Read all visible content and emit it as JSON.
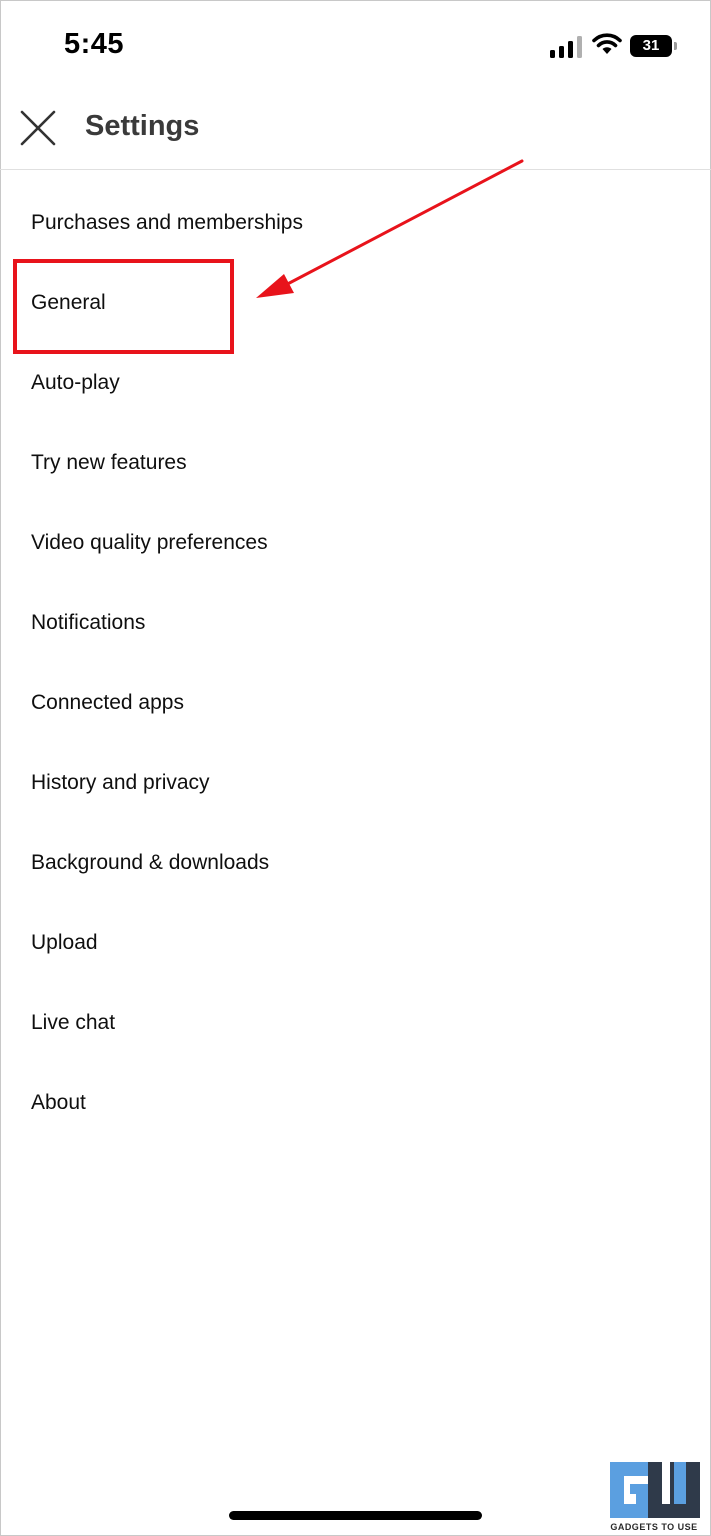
{
  "status_bar": {
    "time": "5:45",
    "battery_level": "31",
    "icons": [
      "signal-bars-icon",
      "wifi-icon",
      "battery-icon"
    ]
  },
  "header": {
    "title": "Settings",
    "close_icon": "close-x-icon"
  },
  "settings": {
    "items": [
      {
        "label": "Purchases and memberships"
      },
      {
        "label": "General"
      },
      {
        "label": "Auto-play"
      },
      {
        "label": "Try new features"
      },
      {
        "label": "Video quality preferences"
      },
      {
        "label": "Notifications"
      },
      {
        "label": "Connected apps"
      },
      {
        "label": "History and privacy"
      },
      {
        "label": "Background & downloads"
      },
      {
        "label": "Upload"
      },
      {
        "label": "Live chat"
      },
      {
        "label": "About"
      }
    ]
  },
  "annotation": {
    "highlighted_item": "General",
    "color": "#e8131b"
  },
  "watermark": {
    "text": "GADGETS TO USE"
  }
}
